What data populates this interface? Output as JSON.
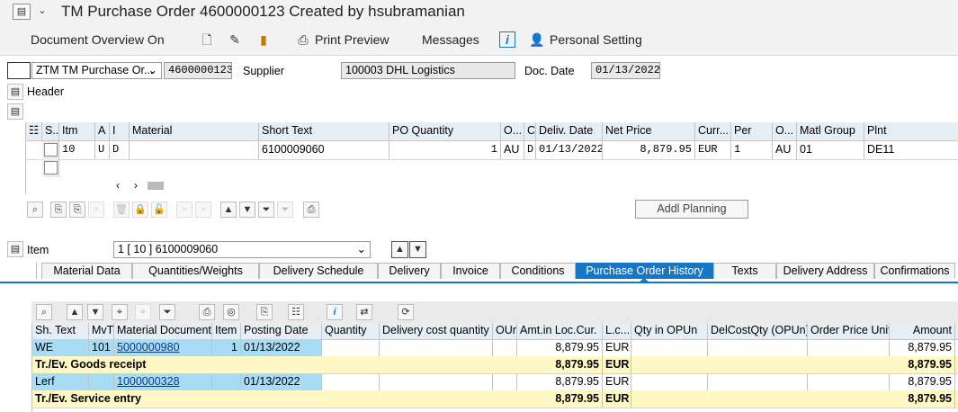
{
  "window": {
    "title": "TM Purchase Order 4600000123 Created by hsubramanian"
  },
  "toolbar": {
    "doc_overview_label": "Document Overview On",
    "print_preview_label": "Print Preview",
    "messages_label": "Messages",
    "personal_setting_label": "Personal Setting"
  },
  "header": {
    "order_type": "ZTM TM Purchase Or...",
    "po_number": "4600000123",
    "supplier_label": "Supplier",
    "supplier_value": "100003 DHL Logistics",
    "doc_date_label": "Doc. Date",
    "doc_date_value": "01/13/2022",
    "header_section_label": "Header"
  },
  "items_grid": {
    "columns": [
      "S..",
      "Itm",
      "A",
      "I",
      "Material",
      "Short Text",
      "PO Quantity",
      "O...",
      "C",
      "Deliv. Date",
      "Net Price",
      "Curr...",
      "Per",
      "O...",
      "Matl Group",
      "Plnt"
    ],
    "rows": [
      {
        "itm": "10",
        "a": "U",
        "i": "D",
        "material": "",
        "short_text": "6100009060",
        "po_qty": "1",
        "oun": "AU",
        "c": "D",
        "deliv_date": "01/13/2022",
        "net_price": "8,879.95",
        "curr": "EUR",
        "per": "1",
        "opu": "AU",
        "matl_group": "01",
        "plnt": "DE11"
      }
    ],
    "addl_planning_label": "Addl Planning"
  },
  "item_detail": {
    "item_label": "Item",
    "item_value": "1 [ 10 ] 6100009060",
    "tabs": [
      "Material Data",
      "Quantities/Weights",
      "Delivery Schedule",
      "Delivery",
      "Invoice",
      "Conditions",
      "Purchase Order History",
      "Texts",
      "Delivery Address",
      "Confirmations"
    ],
    "active_tab": "Purchase Order History"
  },
  "history_grid": {
    "columns": [
      "Sh. Text",
      "MvT",
      "Material Document",
      "Item",
      "Posting Date",
      "Quantity",
      "Delivery cost quantity",
      "OUn",
      "Amt.in Loc.Cur.",
      "L.c...",
      "Qty in OPUn",
      "DelCostQty (OPUn)",
      "Order Price Unit",
      "Amount"
    ],
    "rows": [
      {
        "sh_text": "WE",
        "mvt": "101",
        "mat_doc": "5000000980",
        "item": "1",
        "posting_date": "01/13/2022",
        "amt": "8,879.95",
        "lcur": "EUR",
        "amount": "8,879.95"
      },
      {
        "subtotal": "Tr./Ev. Goods receipt",
        "amt": "8,879.95",
        "lcur": "EUR",
        "amount": "8,879.95"
      },
      {
        "sh_text": "Lerf",
        "mat_doc": "1000000328",
        "posting_date": "01/13/2022",
        "amt": "8,879.95",
        "lcur": "EUR",
        "amount": "8,879.95"
      },
      {
        "subtotal": "Tr./Ev. Service entry",
        "amt": "8,879.95",
        "lcur": "EUR",
        "amount": "8,879.95"
      }
    ]
  }
}
